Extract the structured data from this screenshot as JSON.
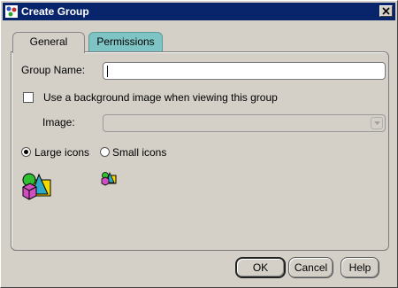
{
  "window": {
    "title": "Create Group",
    "close_label": "close"
  },
  "tabs": [
    {
      "label": "General",
      "active": true
    },
    {
      "label": "Permissions",
      "active": false
    }
  ],
  "general": {
    "group_name_label": "Group Name:",
    "group_name_value": "",
    "background_checkbox_label": "Use a background image when viewing this group",
    "background_checked": false,
    "image_label": "Image:",
    "image_value": "",
    "icon_size_options": [
      {
        "label": "Large icons",
        "selected": true
      },
      {
        "label": "Small icons",
        "selected": false
      }
    ],
    "large_icon": "large-shapes-icon",
    "small_icon": "small-shapes-icon"
  },
  "buttons": {
    "ok": "OK",
    "cancel": "Cancel",
    "help": "Help"
  },
  "colors": {
    "titlebar": "#08246b",
    "tab_permissions": "#7fc4c4",
    "face": "#d4d0c8"
  }
}
